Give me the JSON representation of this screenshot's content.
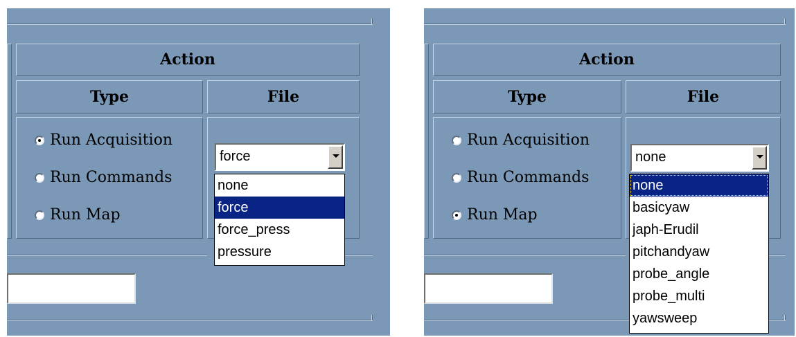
{
  "left": {
    "action_header": "Action",
    "type_header": "Type",
    "file_header": "File",
    "radios": [
      {
        "label": "Run Acquisition",
        "checked": true
      },
      {
        "label": "Run Commands",
        "checked": false
      },
      {
        "label": "Run Map",
        "checked": false
      }
    ],
    "select_value": "force",
    "options": [
      "none",
      "force",
      "force_press",
      "pressure"
    ],
    "highlighted_option": "force",
    "filename_input_value": ""
  },
  "right": {
    "action_header": "Action",
    "type_header": "Type",
    "file_header": "File",
    "radios": [
      {
        "label": "Run Acquisition",
        "checked": false
      },
      {
        "label": "Run Commands",
        "checked": false
      },
      {
        "label": "Run Map",
        "checked": true
      }
    ],
    "select_value": "none",
    "options": [
      "none",
      "basicyaw",
      "japh-Erudil",
      "pitchandyaw",
      "probe_angle",
      "probe_multi",
      "yawsweep"
    ],
    "highlighted_option": "none",
    "filename_input_value": ""
  },
  "colors": {
    "panel_bg": "#7b98b6",
    "selection_bg": "#0a2486",
    "selection_text": "#ffffff"
  },
  "icons": {
    "radio_button": "radio-icon",
    "dropdown_arrow": "chevron-down-icon"
  }
}
